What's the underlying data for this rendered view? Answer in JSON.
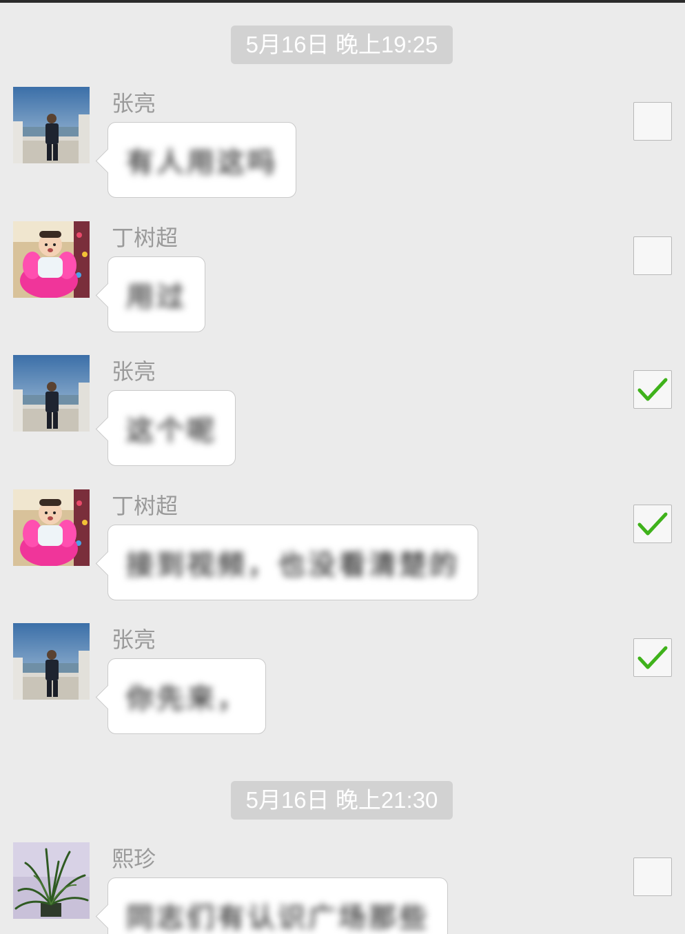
{
  "colors": {
    "background": "#ebebeb",
    "timestamp_bg": "#d2d2d2",
    "check_green": "#3fb21b"
  },
  "timestamps": [
    "5月16日 晚上19:25",
    "5月16日 晚上21:30"
  ],
  "messages": [
    {
      "sender": "张亮",
      "avatar": "man-by-lake-avatar",
      "text": "有人用这吗",
      "selected": false
    },
    {
      "sender": "丁树超",
      "avatar": "baby-pink-chair-avatar",
      "text": "用过",
      "selected": false
    },
    {
      "sender": "张亮",
      "avatar": "man-by-lake-avatar",
      "text": "这个呢",
      "selected": true
    },
    {
      "sender": "丁树超",
      "avatar": "baby-pink-chair-avatar",
      "text": "接到视频，也没看清楚的",
      "selected": true
    },
    {
      "sender": "张亮",
      "avatar": "man-by-lake-avatar",
      "text": "你先来，",
      "selected": true
    },
    {
      "sender": "熙珍",
      "avatar": "potted-plant-avatar",
      "text": "同志们有认识广场那些",
      "selected": false
    }
  ]
}
